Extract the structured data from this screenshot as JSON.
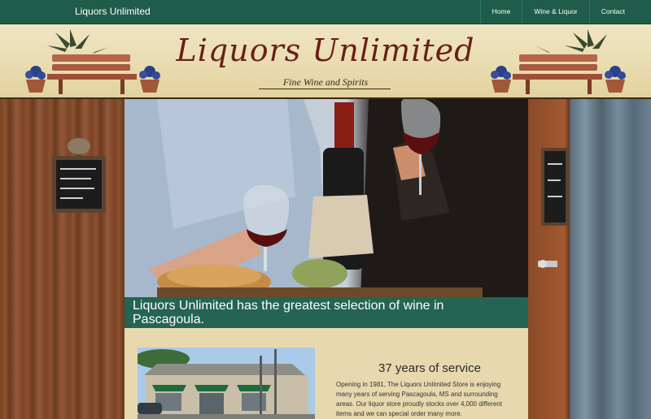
{
  "nav": {
    "brand": "Liquors Unlimited",
    "links": [
      {
        "label": "Home"
      },
      {
        "label": "Wine & Liquor"
      },
      {
        "label": "Contact"
      }
    ]
  },
  "banner": {
    "title": "Liquors Unlimited",
    "subtitle": "Fine Wine and Spirits"
  },
  "hero": {
    "caption": "Liquors Unlimited has the greatest selection of wine in Pascagoula."
  },
  "service": {
    "title": "37 years of service",
    "text": "Opening in 1981, The Liquors Unlimited Store is enjoying many years of serving Pascagoula, MS and surrounding areas. Our liquor store proudly stocks over 4,000 different items and we can special order many more."
  },
  "colors": {
    "nav_bg": "#1f5c49",
    "accent_green": "#246452",
    "logo_red": "#6a1f1a",
    "banner_bg": "#e9dcb0"
  }
}
